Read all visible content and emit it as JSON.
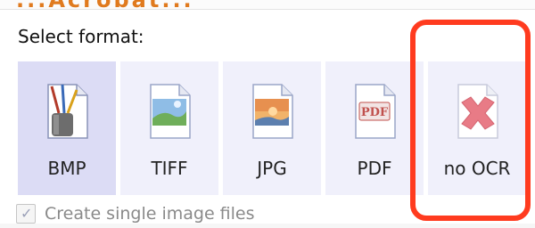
{
  "window": {
    "clipped_title": "...Acrobat..."
  },
  "section": {
    "heading": "Select format:"
  },
  "formats": [
    {
      "label": "BMP",
      "icon": "bmp-paint-file-icon",
      "selected": true
    },
    {
      "label": "TIFF",
      "icon": "tiff-image-file-icon",
      "selected": false
    },
    {
      "label": "JPG",
      "icon": "jpg-image-file-icon",
      "selected": false
    },
    {
      "label": "PDF",
      "icon": "pdf-file-icon",
      "selected": false
    },
    {
      "label": "no OCR",
      "icon": "no-ocr-red-x-icon",
      "selected": false
    }
  ],
  "options": {
    "single_files_label": "Create single image files",
    "single_files_checked": true,
    "single_files_enabled": false
  },
  "annotation": {
    "color": "#ff3b1f"
  },
  "colors": {
    "selected_bg": "#dcdcf5",
    "tile_bg": "#f0f0fb"
  }
}
